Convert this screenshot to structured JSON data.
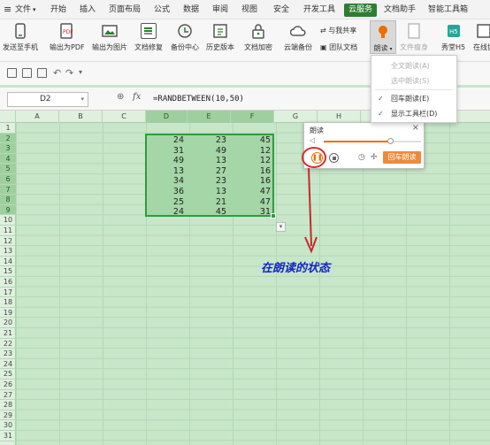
{
  "menubar": {
    "file": "文件",
    "tabs": [
      "开始",
      "插入",
      "页面布局",
      "公式",
      "数据",
      "审阅",
      "视图",
      "安全",
      "开发工具",
      "云服务",
      "文档助手",
      "智能工具箱"
    ]
  },
  "ribbon": {
    "items": [
      "发送至手机",
      "输出为PDF",
      "输出为图片",
      "文档修复",
      "备份中心",
      "历史版本",
      "文档加密",
      "云端备份",
      "朗读",
      "文件瘦身",
      "秀堂H5",
      "在线协"
    ],
    "share": "与我共享",
    "team": "团队文档"
  },
  "formula": {
    "cell_ref": "D2",
    "fx": "fx",
    "content": "=RANDBETWEEN(10,50)"
  },
  "columns": [
    "A",
    "B",
    "C",
    "D",
    "E",
    "F",
    "G",
    "H",
    "I",
    "J"
  ],
  "rows": [
    "1",
    "2",
    "3",
    "4",
    "5",
    "6",
    "7",
    "8",
    "9",
    "10",
    "11",
    "12",
    "13",
    "14",
    "15",
    "16",
    "17",
    "18",
    "19",
    "20",
    "21",
    "22",
    "23",
    "24",
    "25",
    "26",
    "27",
    "28",
    "29",
    "30",
    "31"
  ],
  "cells": [
    [
      24,
      23,
      45
    ],
    [
      31,
      49,
      12
    ],
    [
      49,
      13,
      12
    ],
    [
      13,
      27,
      16
    ],
    [
      34,
      23,
      16
    ],
    [
      36,
      13,
      47
    ],
    [
      25,
      21,
      47
    ],
    [
      24,
      45,
      31
    ]
  ],
  "dialog": {
    "title": "朗读",
    "close": "×",
    "read_button": "回车朗读"
  },
  "read_menu": {
    "items": [
      {
        "label": "全文朗读(A)",
        "state": "disabled"
      },
      {
        "label": "选中朗读(S)",
        "state": "disabled"
      },
      {
        "label": "回车朗读(E)",
        "state": "checked"
      },
      {
        "label": "显示工具栏(D)",
        "state": "checked"
      }
    ]
  },
  "annotation": "在朗读的状态",
  "colors": {
    "accent": "#2e7d32",
    "grid": "#c8e6c9",
    "annotation": "#1424c8",
    "arrow": "#d32f2f"
  }
}
